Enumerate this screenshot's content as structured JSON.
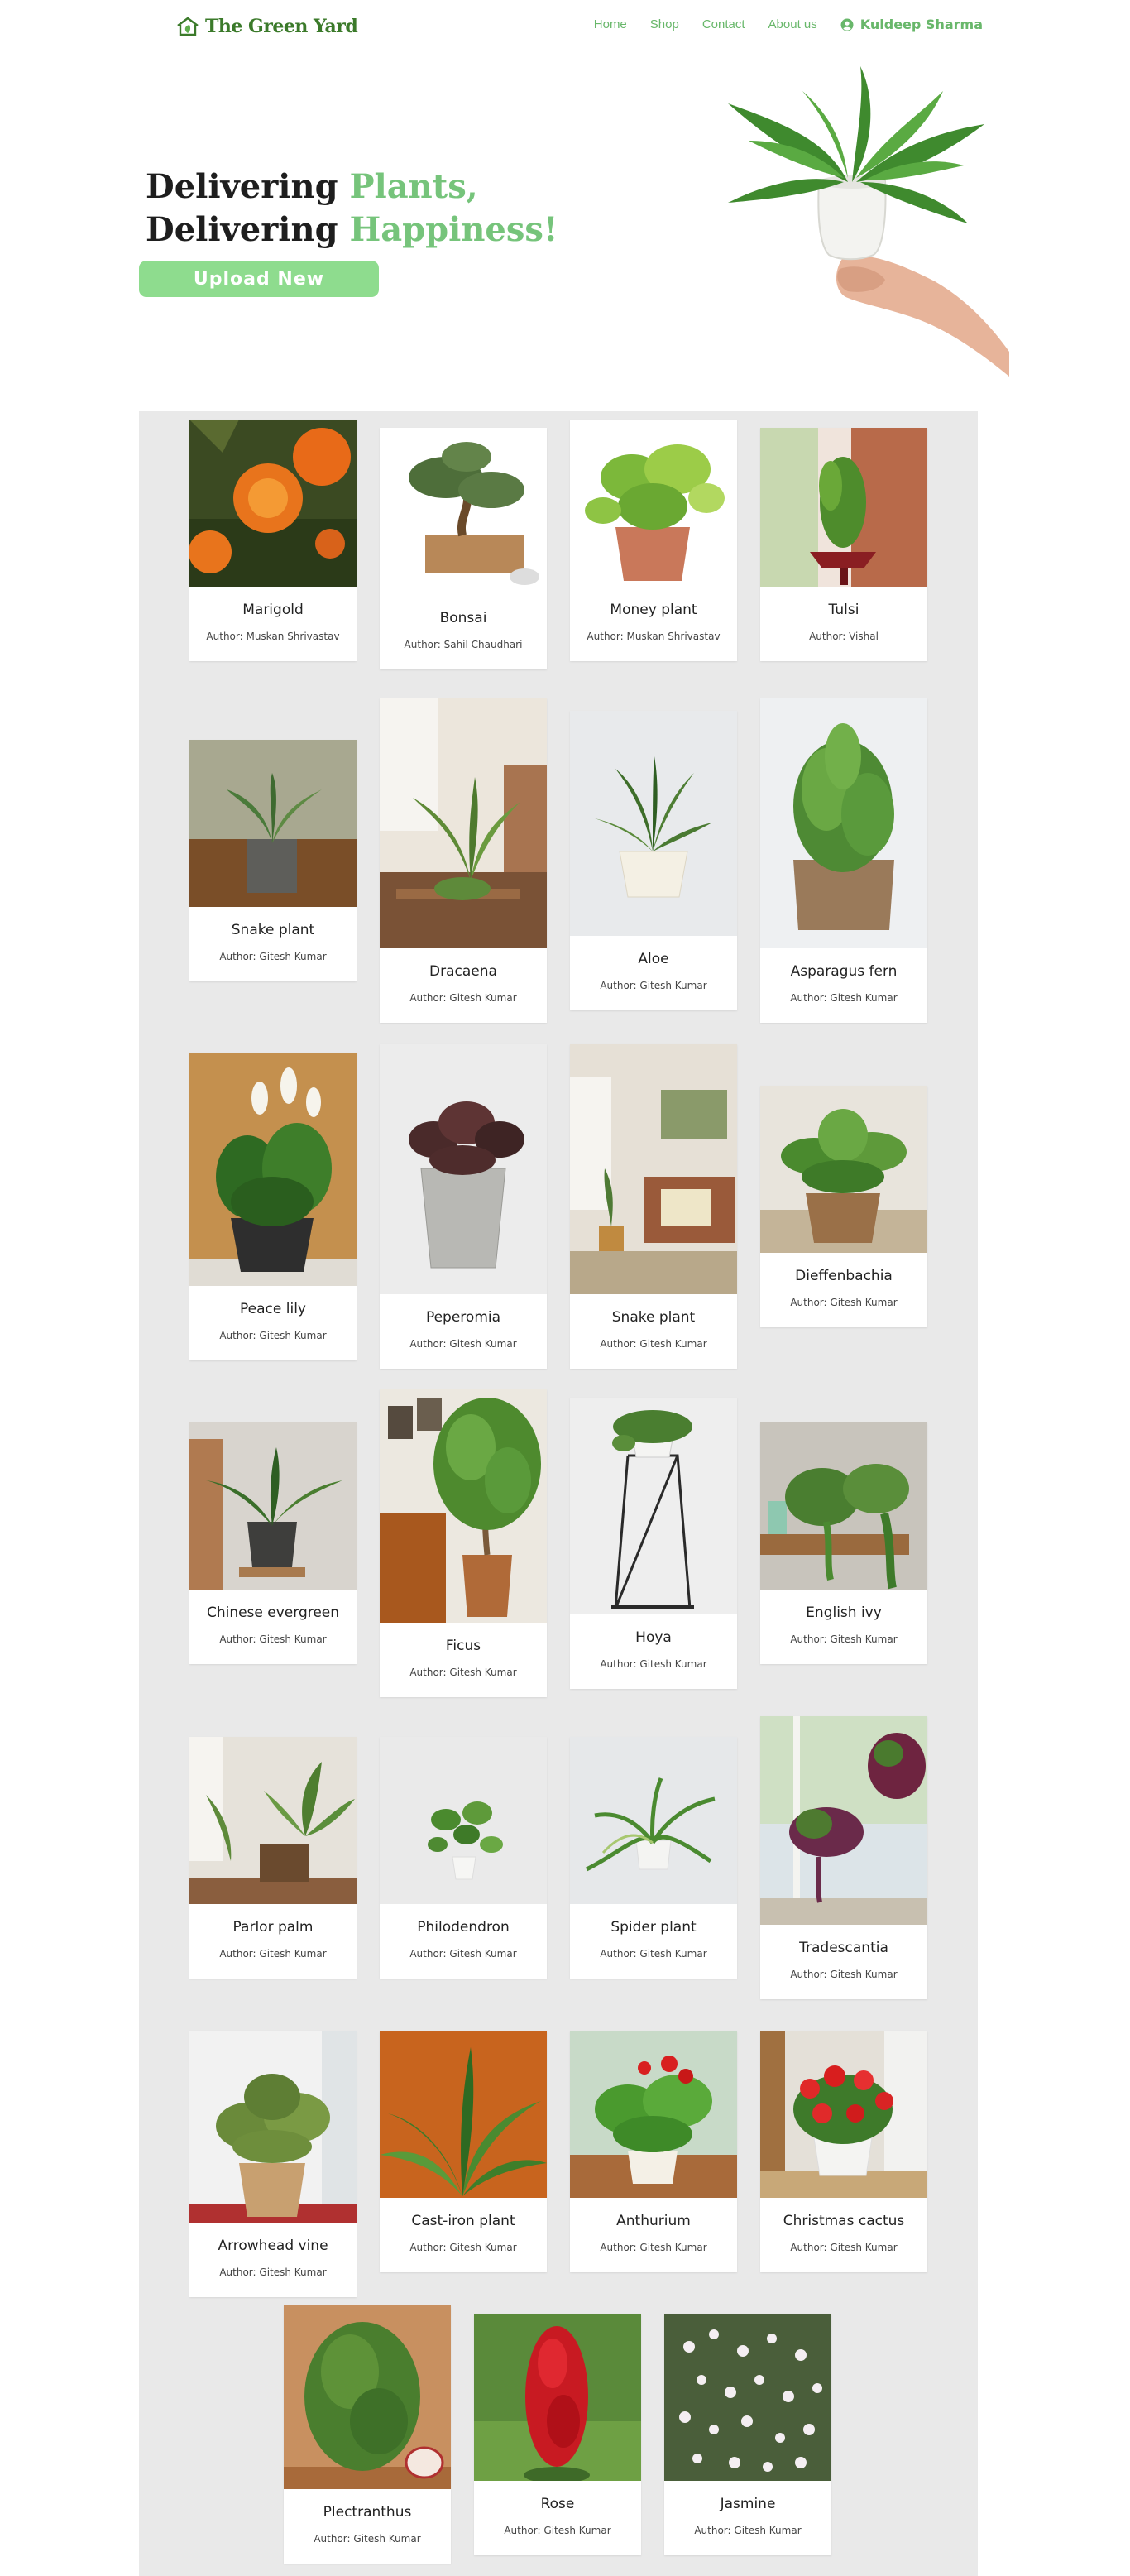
{
  "nav": {
    "logo_text": "The Green Yard",
    "links": [
      "Home",
      "Shop",
      "Contact",
      "About us"
    ],
    "user_name": "Kuldeep Sharma"
  },
  "hero": {
    "line1_plain": "Delivering ",
    "line1_accent": "Plants,",
    "line2_plain": "Delivering ",
    "line2_accent": "Happiness!",
    "upload_label": "Upload New"
  },
  "colors": {
    "accent_green": "#76c47b",
    "button_green": "#8edc8e",
    "gallery_bg": "#e9e9e9"
  },
  "plants": [
    {
      "name": "Marigold",
      "author": "Author: Muskan Shrivastav"
    },
    {
      "name": "Bonsai",
      "author": "Author: Sahil Chaudhari"
    },
    {
      "name": "Money plant",
      "author": "Author: Muskan Shrivastav"
    },
    {
      "name": "Tulsi",
      "author": "Author: Vishal"
    },
    {
      "name": "Snake plant",
      "author": "Author: Gitesh Kumar"
    },
    {
      "name": "Dracaena",
      "author": "Author: Gitesh Kumar"
    },
    {
      "name": "Aloe",
      "author": "Author: Gitesh Kumar"
    },
    {
      "name": "Asparagus fern",
      "author": "Author: Gitesh Kumar"
    },
    {
      "name": "Peace lily",
      "author": "Author: Gitesh Kumar"
    },
    {
      "name": "Peperomia",
      "author": "Author: Gitesh Kumar"
    },
    {
      "name": "Snake plant",
      "author": "Author: Gitesh Kumar"
    },
    {
      "name": "Dieffenbachia",
      "author": "Author: Gitesh Kumar"
    },
    {
      "name": "Chinese evergreen",
      "author": "Author: Gitesh Kumar"
    },
    {
      "name": "Ficus",
      "author": "Author: Gitesh Kumar"
    },
    {
      "name": "Hoya",
      "author": "Author: Gitesh Kumar"
    },
    {
      "name": "English ivy",
      "author": "Author: Gitesh Kumar"
    },
    {
      "name": "Parlor palm",
      "author": "Author: Gitesh Kumar"
    },
    {
      "name": "Philodendron",
      "author": "Author: Gitesh Kumar"
    },
    {
      "name": "Spider plant",
      "author": "Author: Gitesh Kumar"
    },
    {
      "name": "Tradescantia",
      "author": "Author: Gitesh Kumar"
    },
    {
      "name": "Arrowhead vine",
      "author": "Author: Gitesh Kumar"
    },
    {
      "name": "Cast-iron plant",
      "author": "Author: Gitesh Kumar"
    },
    {
      "name": "Anthurium",
      "author": "Author: Gitesh Kumar"
    },
    {
      "name": "Christmas cactus",
      "author": "Author: Gitesh Kumar"
    },
    {
      "name": "Plectranthus",
      "author": "Author: Gitesh Kumar"
    },
    {
      "name": "Rose",
      "author": "Author: Gitesh Kumar"
    },
    {
      "name": "Jasmine",
      "author": "Author: Gitesh Kumar"
    }
  ]
}
